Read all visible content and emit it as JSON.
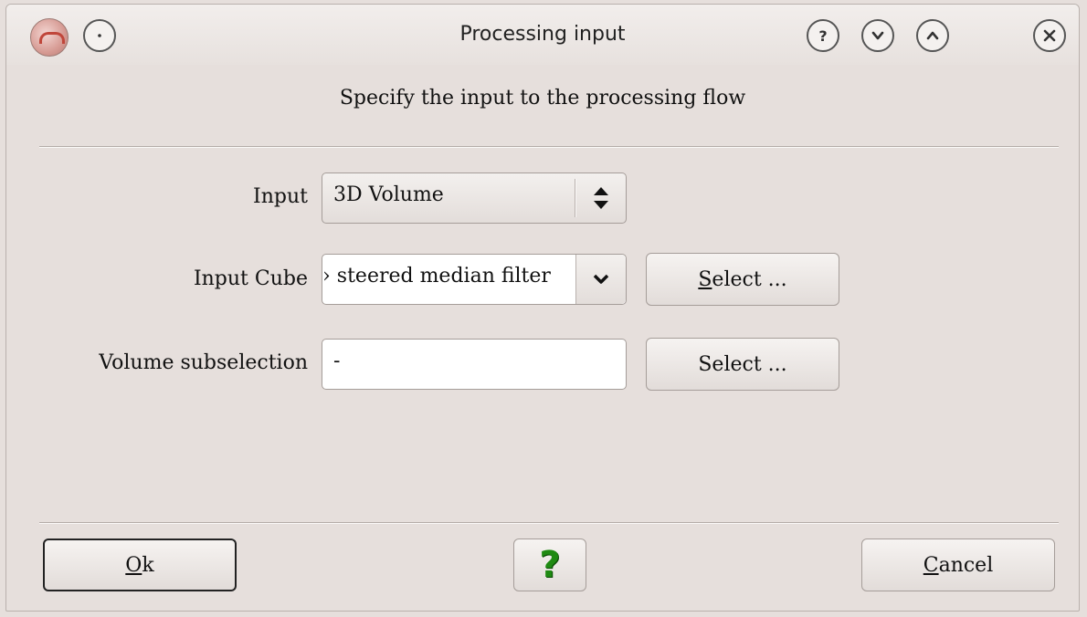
{
  "window": {
    "title": "Processing input"
  },
  "heading": "Specify the input to the processing flow",
  "form": {
    "input_label": "Input",
    "input_value": "3D Volume",
    "input_cube_label": "Input Cube",
    "input_cube_value": "› steered median filter",
    "input_cube_select_first": "S",
    "input_cube_select_rest": "elect ...",
    "volume_subsel_label": "Volume subselection",
    "volume_subsel_value": "-",
    "volume_subsel_select": "Select ..."
  },
  "footer": {
    "ok_first": "O",
    "ok_rest": "k",
    "help_glyph": "?",
    "cancel_first": "C",
    "cancel_rest": "ancel"
  },
  "colors": {
    "background": "#e6dfdc",
    "help_green": "#1f8a12"
  },
  "icons": [
    "app-icon",
    "shade-icon",
    "help-icon",
    "minimize-icon",
    "maximize-icon",
    "close-icon",
    "spinner-arrows-icon",
    "chevron-down-icon",
    "question-mark-icon"
  ]
}
